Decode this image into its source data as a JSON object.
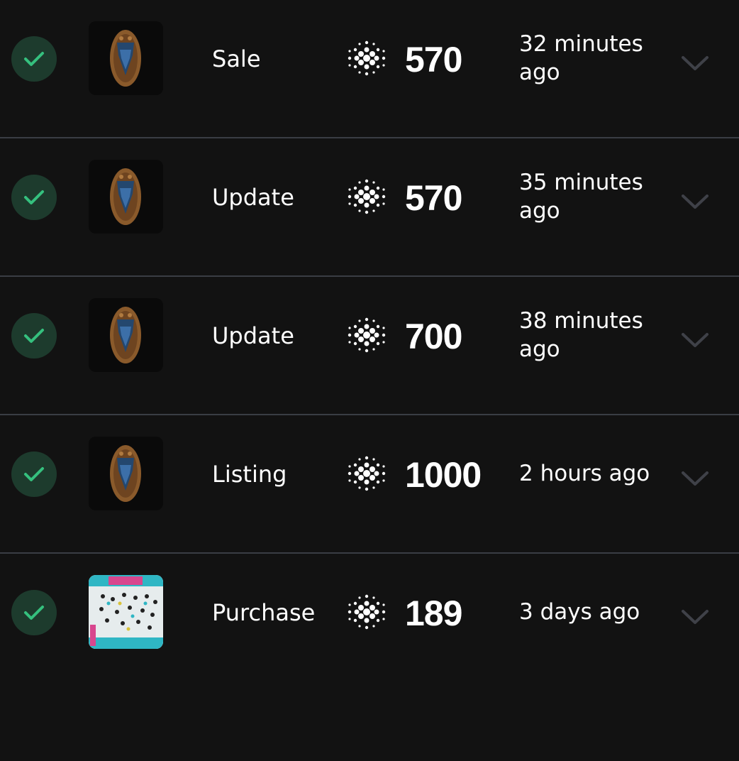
{
  "transactions": [
    {
      "status_icon": "check-icon",
      "thumbnail": "bronze-shield-nft",
      "type": "Sale",
      "currency_icon": "cardano-ada-icon",
      "amount": "570",
      "time": "32 minutes ago"
    },
    {
      "status_icon": "check-icon",
      "thumbnail": "bronze-shield-nft",
      "type": "Update",
      "currency_icon": "cardano-ada-icon",
      "amount": "570",
      "time": "35 minutes ago"
    },
    {
      "status_icon": "check-icon",
      "thumbnail": "bronze-shield-nft",
      "type": "Update",
      "currency_icon": "cardano-ada-icon",
      "amount": "700",
      "time": "38 minutes ago"
    },
    {
      "status_icon": "check-icon",
      "thumbnail": "bronze-shield-nft",
      "type": "Listing",
      "currency_icon": "cardano-ada-icon",
      "amount": "1000",
      "time": "2 hours ago"
    },
    {
      "status_icon": "check-icon",
      "thumbnail": "colorful-map-nft",
      "type": "Purchase",
      "currency_icon": "cardano-ada-icon",
      "amount": "189",
      "time": "3 days ago"
    }
  ],
  "colors": {
    "background": "#121212",
    "divider": "#3a3d44",
    "status_bg": "#1d3b2d",
    "check": "#35c07e",
    "chevron": "#3f4148"
  }
}
